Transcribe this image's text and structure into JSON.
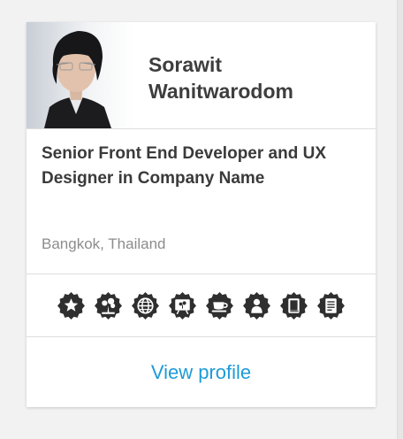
{
  "profile": {
    "name": "Sorawit Wanitwarodom",
    "title": "Senior Front End Developer and UX Designer in Company Name",
    "location": "Bangkok, Thailand",
    "view_profile_label": "View profile"
  },
  "badges": [
    {
      "icon": "star-badge-icon"
    },
    {
      "icon": "tree-badge-icon"
    },
    {
      "icon": "globe-badge-icon"
    },
    {
      "icon": "presentation-badge-icon"
    },
    {
      "icon": "coffee-badge-icon"
    },
    {
      "icon": "person-badge-icon"
    },
    {
      "icon": "book-badge-icon"
    },
    {
      "icon": "document-badge-icon"
    }
  ],
  "colors": {
    "badge": "#2f2f2f",
    "link": "#1e9bd7",
    "name_text": "#3e3e3e",
    "location_text": "#8c8c8c"
  }
}
